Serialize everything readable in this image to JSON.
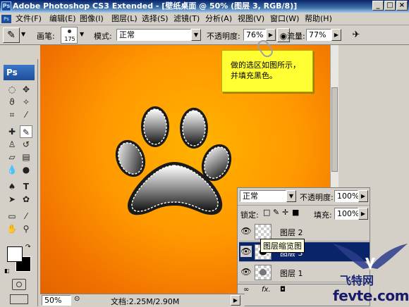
{
  "window": {
    "title": "Adobe Photoshop CS3 Extended - [壁纸桌面 @ 50% (图层 3, RGB/8)]",
    "app_badge": "Ps"
  },
  "menubar": {
    "items": [
      "文件(F)",
      "编辑(E)",
      "图像(I)",
      "图层(L)",
      "选择(S)",
      "滤镜(T)",
      "分析(A)",
      "视图(V)",
      "窗口(W)",
      "帮助(H)"
    ]
  },
  "options": {
    "brush_label": "画笔:",
    "brush_size": "175",
    "mode_label": "模式:",
    "mode_value": "正常",
    "opacity_label": "不透明度:",
    "opacity_value": "76%",
    "flow_label": "流量:",
    "flow_value": "77%"
  },
  "toolbox": {
    "logo": "Ps"
  },
  "note": {
    "line1": "做的选区如图所示，",
    "line2": "并填充黑色。"
  },
  "layers_panel": {
    "blend_mode": "正常",
    "opacity_label": "不透明度:",
    "opacity_value": "100%",
    "lock_label": "锁定:",
    "fill_label": "填充:",
    "fill_value": "100%",
    "layers": [
      {
        "name": "图层 2",
        "selected": false
      },
      {
        "name": "图层 3",
        "selected": true
      },
      {
        "name": "图层 1",
        "selected": false
      }
    ],
    "tooltip": "图层缩览图"
  },
  "status": {
    "zoom": "50%",
    "doc": "文档:2.25M/2.90M"
  },
  "watermark": {
    "text1": "飞特网",
    "text2": "fevte.com"
  },
  "colors": {
    "canvas_center": "#ffb300",
    "canvas_edge": "#e26400",
    "selected_row": "#0a246a",
    "note_bg": "#ffff33"
  }
}
